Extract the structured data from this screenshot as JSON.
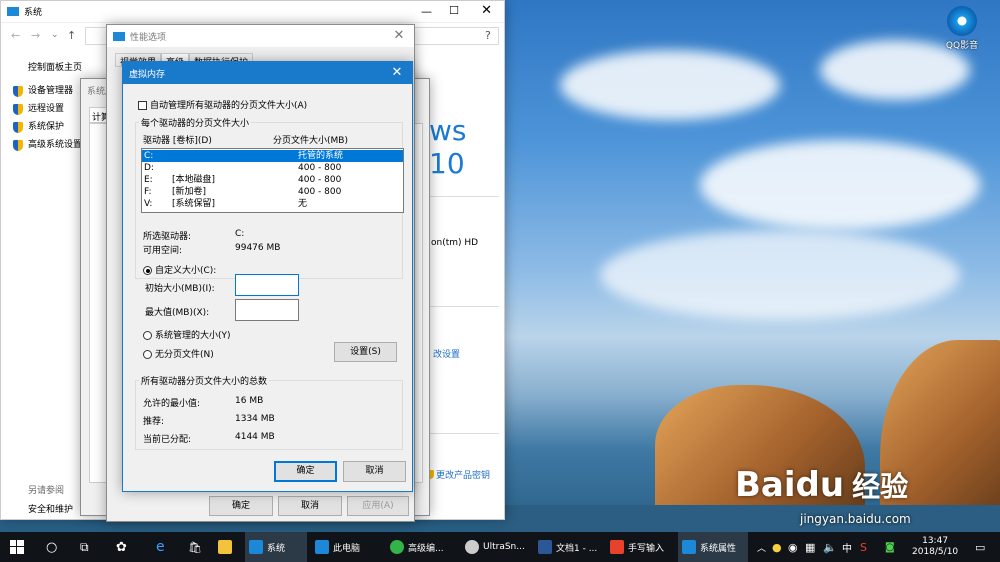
{
  "desktop": {
    "qq_icon_label": "QQ影音",
    "watermark_brand": "Baidu",
    "watermark_cn": "经验",
    "watermark_url": "jingyan.baidu.com"
  },
  "system_window": {
    "title": "系统",
    "breadcrumb": "控制面板主页",
    "left_links": [
      "设备管理器",
      "远程设置",
      "系统保护",
      "高级系统设置"
    ],
    "see_also": "另请参阅",
    "security": "安全和维护",
    "windows_brand": "ws 10",
    "cpu_fragment": "on(tm) HD",
    "change_settings": "改设置",
    "change_key": "更改产品密钥"
  },
  "sysprops_window": {
    "title": "系统属性",
    "tab_fragment": "计算"
  },
  "perf_window": {
    "title": "性能选项",
    "tabs": [
      "视觉效果",
      "高级",
      "数据执行保护"
    ],
    "ok": "确定",
    "cancel": "取消",
    "apply": "应用(A)"
  },
  "vm_dialog": {
    "title": "虚拟内存",
    "auto_manage": "自动管理所有驱动器的分页文件大小(A)",
    "group_each": "每个驱动器的分页文件大小",
    "col_drive": "驱动器 [卷标](D)",
    "col_size": "分页文件大小(MB)",
    "drives": [
      {
        "drive": "C:",
        "label": "",
        "size": "托管的系统"
      },
      {
        "drive": "D:",
        "label": "",
        "size": "400 - 800"
      },
      {
        "drive": "E:",
        "label": "[本地磁盘]",
        "size": "400 - 800"
      },
      {
        "drive": "F:",
        "label": "[新加卷]",
        "size": "400 - 800"
      },
      {
        "drive": "V:",
        "label": "[系统保留]",
        "size": "无"
      }
    ],
    "selected_drive_label": "所选驱动器:",
    "selected_drive": "C:",
    "free_space_label": "可用空间:",
    "free_space": "99476 MB",
    "custom_size": "自定义大小(C):",
    "initial_size_label": "初始大小(MB)(I):",
    "initial_size": "",
    "max_size_label": "最大值(MB)(X):",
    "max_size": "",
    "system_managed": "系统管理的大小(Y)",
    "no_paging": "无分页文件(N)",
    "set_button": "设置(S)",
    "group_total": "所有驱动器分页文件大小的总数",
    "min_allowed_label": "允许的最小值:",
    "min_allowed": "16 MB",
    "recommended_label": "推荐:",
    "recommended": "1334 MB",
    "current_label": "当前已分配:",
    "current": "4144 MB",
    "ok": "确定",
    "cancel": "取消"
  },
  "taskbar": {
    "apps": [
      "系统",
      "此电脑",
      "高级编...",
      "UltraSn...",
      "文档1 - ...",
      "手写输入",
      "系统属性"
    ],
    "lang": "中",
    "time": "13:47",
    "date": "2018/5/10"
  }
}
